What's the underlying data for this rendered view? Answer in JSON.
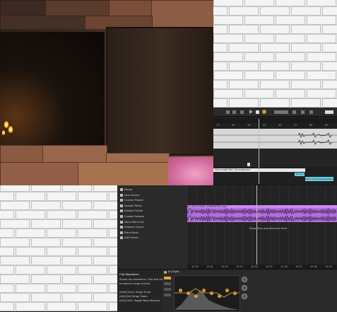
{
  "daw": {
    "top": {
      "timeline_marks": [
        "17",
        "25",
        "33",
        "41",
        "49",
        "57",
        "65",
        "81"
      ],
      "clip_bar_label": "Voice Label Mix / Arrangement",
      "tag_1": "Voice 2",
      "tag_2": "Voice Track Seperate Bars"
    },
    "browser": {
      "items": [
        "Places",
        "User Library",
        "Current Project",
        "Sample Packs",
        "Artwork Folder",
        "Crowds Sample",
        "Voice Word List",
        "Ambient Sound",
        "Piano Book",
        "Add Folder..."
      ]
    },
    "arrangement": {
      "clip_title": "A1_0003_FADE_CONVERTED.wav",
      "hint_text": "Drop Files and Devices Here",
      "time_marks": [
        "10:30",
        "10:31",
        "10:32",
        "10:33",
        "10:34",
        "10:35",
        "10:36",
        "10:37",
        "10:38",
        "10:39"
      ]
    },
    "info": {
      "title": "Clip Waveform",
      "lines": [
        "Shows clip waveform. Click and drag",
        "to select a range of time.",
        "",
        "[Shift] Click / Drag: Scroll.",
        "[Alt] [Ctrl] Drag: Zoom.",
        "[Ctrl] Click: Toggle Warp Markers."
      ]
    },
    "device": {
      "title": "EQ Eight",
      "bands": [
        "1",
        "2",
        "3",
        "4",
        "5",
        "6",
        "7",
        "8"
      ]
    }
  },
  "colors": {
    "clip": "#b070d8",
    "tag": "#66ccdd",
    "device_bands": "#e8a838"
  }
}
